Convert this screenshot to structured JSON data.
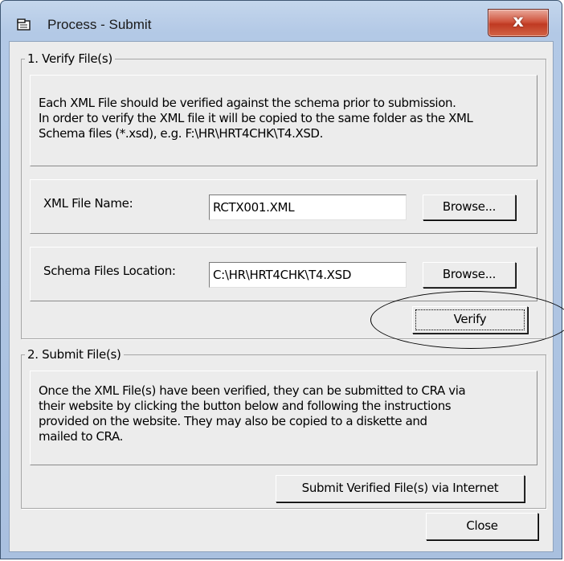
{
  "window": {
    "title": "Process - Submit",
    "close_glyph": "x"
  },
  "icons": {
    "app": "process-window-icon",
    "close": "close-icon"
  },
  "verify_group": {
    "label": "1. Verify File(s)",
    "description": [
      "Each XML File should be verified against the schema prior to submission.",
      "In order to verify the XML file it will be copied to the same folder as the XML",
      "Schema files (*.xsd), e.g. F:\\HR\\HRT4CHK\\T4.XSD."
    ],
    "xml_file": {
      "label": "XML File Name:",
      "value": "RCTX001.XML",
      "browse_label": "Browse..."
    },
    "schema": {
      "label": "Schema Files Location:",
      "value": "C:\\HR\\HRT4CHK\\T4.XSD",
      "browse_label": "Browse..."
    },
    "verify_label": "Verify"
  },
  "submit_group": {
    "label": "2. Submit File(s)",
    "description": [
      "Once the XML File(s) have been verified, they can be submitted to CRA via",
      "their website by clicking the button below and following the instructions",
      "provided on the website.  They may also be copied to a diskette and",
      "mailed to CRA."
    ],
    "submit_label": "Submit Verified File(s) via Internet"
  },
  "close_label": "Close",
  "colors": {
    "title_bar": "#b3c9e6",
    "client": "#ececec",
    "close_button": "#c03a22"
  }
}
